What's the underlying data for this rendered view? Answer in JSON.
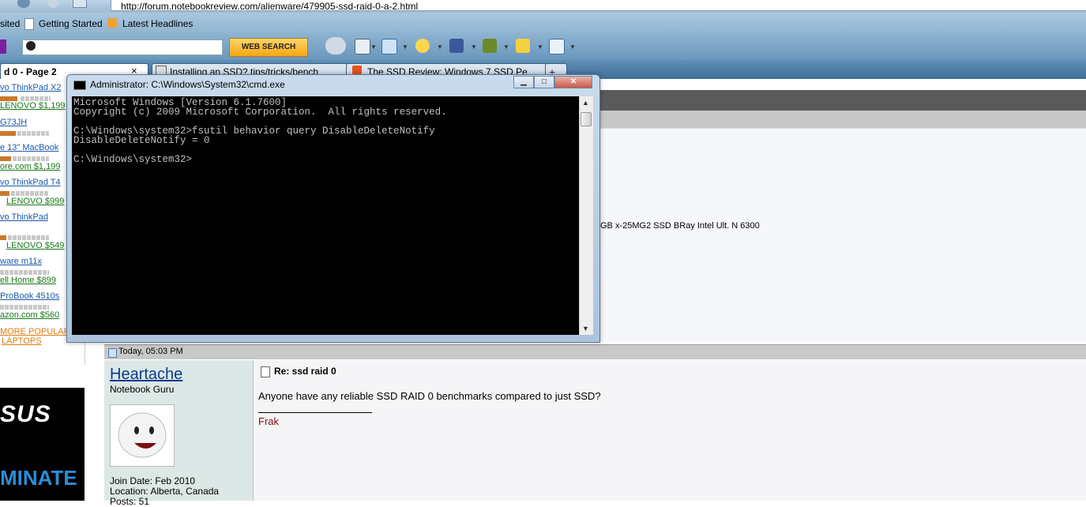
{
  "browser": {
    "url": "http://forum.notebookreview.com/alienware/479905-ssd-raid-0-a-2.html",
    "bookmarks": [
      "sited",
      "Getting Started",
      "Latest Headlines"
    ],
    "search_button": "WEB SEARCH",
    "tabs": [
      {
        "label": "d 0 - Page 2",
        "close": "×"
      },
      {
        "label": "Installing an SSD? tips/tricks/bench"
      },
      {
        "label": "The SSD Review: Windows 7 SSD Pe"
      },
      {
        "label": "+"
      }
    ]
  },
  "left_ads": {
    "items": [
      {
        "title": "vo ThinkPad X2",
        "price": "LENOVO $1,199"
      },
      {
        "title": "G73JH",
        "price": ""
      },
      {
        "title": "e 13\" MacBook",
        "price": "ore.com $1,199"
      },
      {
        "title": "vo ThinkPad T4",
        "price": "LENOVO $999"
      },
      {
        "title": "vo ThinkPad",
        "price": "LENOVO $549"
      },
      {
        "title": "ware m11x",
        "price": "ell Home $899"
      },
      {
        "title": "ProBook 4510s",
        "price": "azon.com $560"
      }
    ],
    "more_popular": "MORE POPULAR",
    "laptops": "LAPTOPS",
    "asus_top": "SUS",
    "asus_bottom": "MINATE"
  },
  "cmd": {
    "title": "Administrator: C:\\Windows\\System32\\cmd.exe",
    "lines": [
      "Microsoft Windows [Version 6.1.7600]",
      "Copyright (c) 2009 Microsoft Corporation.  All rights reserved.",
      "",
      "C:\\Windows\\system32>fsutil behavior query DisableDeleteNotify",
      "DisableDeleteNotify = 0",
      "",
      "C:\\Windows\\system32>"
    ]
  },
  "forum": {
    "signature_specs": "GB x-25MG2 SSD  BRay  Intel Ult. N 6300",
    "post": {
      "date": "Today, 05:03 PM",
      "username": "Heartache",
      "user_title": "Notebook Guru",
      "join_date": "Join Date: Feb 2010",
      "location": "Location: Alberta, Canada",
      "posts": "Posts: 51",
      "title": "Re: ssd raid 0",
      "body": "Anyone have any reliable SSD RAID 0 benchmarks compared to just SSD?",
      "signature": "Frak"
    }
  },
  "colors": {
    "console_bg": "#000000",
    "console_text": "#c0c0c0",
    "link_blue": "#1a5aa8",
    "username_blue": "#0c3a8a"
  }
}
